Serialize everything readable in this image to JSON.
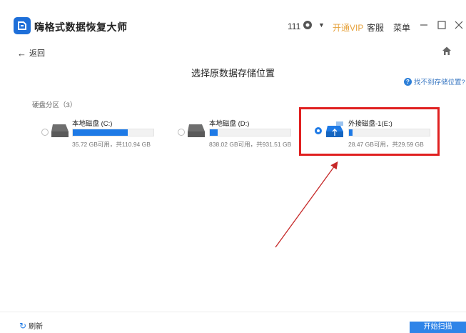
{
  "app": {
    "title": "嗨格式数据恢复大师"
  },
  "header": {
    "user_count": "111",
    "vip_label": "开通VIP",
    "service_label": "客服",
    "menu_label": "菜单",
    "accent": "#1e7ae6",
    "vip_color": "#e6a23c"
  },
  "nav": {
    "back_label": "返回"
  },
  "page": {
    "title": "选择原数据存储位置",
    "help_link": "找不到存储位置?"
  },
  "section": {
    "label": "硬盘分区（3）"
  },
  "disks": [
    {
      "name": "本地磁盘 (C:)",
      "capacity": "35.72 GB可用，共110.94 GB",
      "used_fraction": 0.68,
      "selected": false,
      "icon": "hard-drive-icon"
    },
    {
      "name": "本地磁盘 (D:)",
      "capacity": "838.02 GB可用，共931.51 GB",
      "used_fraction": 0.1,
      "selected": false,
      "icon": "hard-drive-icon"
    },
    {
      "name": "外接磁盘-1(E:)",
      "capacity": "28.47 GB可用，共29.59 GB",
      "used_fraction": 0.04,
      "selected": true,
      "icon": "usb-drive-icon"
    }
  ],
  "footer": {
    "refresh_label": "刷新",
    "start_label": "开始扫描"
  },
  "annotation": {
    "color": "#e02020"
  }
}
